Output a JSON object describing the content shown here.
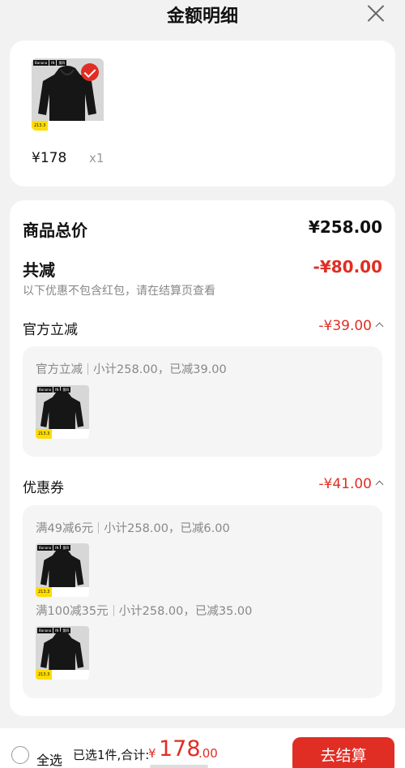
{
  "header": {
    "title": "金额明细"
  },
  "product": {
    "price": "¥178",
    "qty": "x1",
    "thumb_tags": [
      "Banana",
      "IN",
      "第四"
    ],
    "thumb_price": "213.3"
  },
  "detail": {
    "total_label": "商品总价",
    "total_value": "¥258.00",
    "discount_label": "共减",
    "discount_value": "-¥80.00",
    "discount_note": "以下优惠不包含红包，请在结算页查看",
    "official": {
      "label": "官方立减",
      "value": "-¥39.00",
      "line_a": "官方立减",
      "line_b": "小计258.00，已减39.00"
    },
    "coupon": {
      "label": "优惠券",
      "value": "-¥41.00",
      "items": [
        {
          "name": "满49减6元",
          "detail": "小计258.00，已减6.00"
        },
        {
          "name": "满100减35元",
          "detail": "小计258.00，已减35.00"
        }
      ]
    }
  },
  "footer": {
    "select_all": "全选",
    "summary": "已选1件,合计:",
    "currency": "¥",
    "amount_int": "178",
    "amount_dec": ".00",
    "checkout": "去结算"
  },
  "colors": {
    "accent": "#e02e24",
    "muted": "#888888",
    "background": "#f2f2f2"
  }
}
